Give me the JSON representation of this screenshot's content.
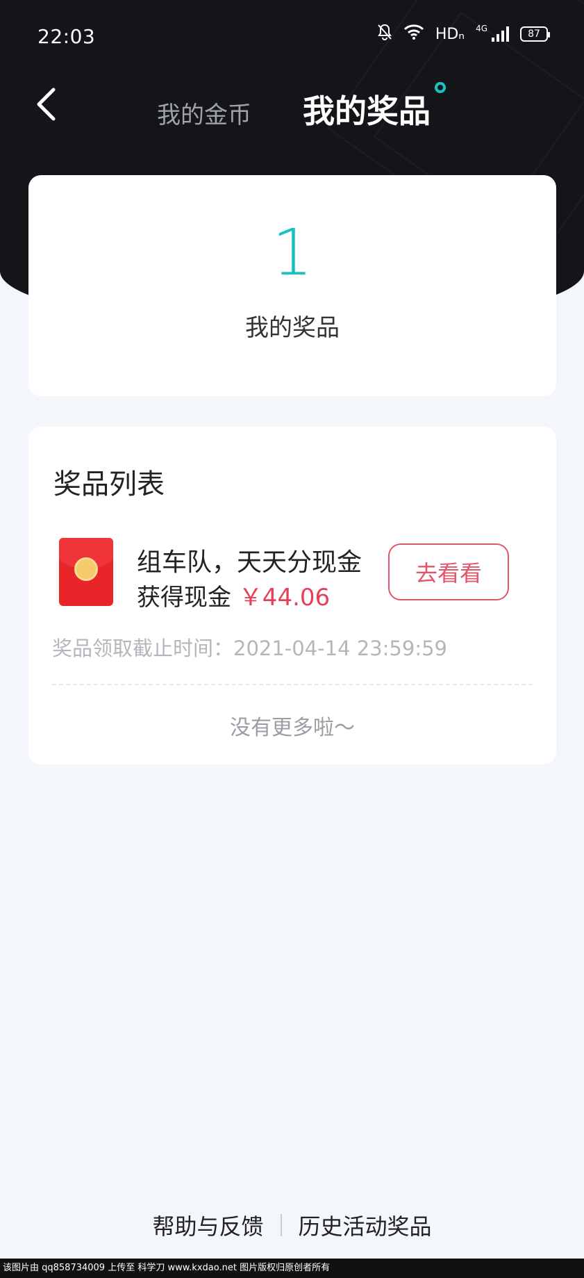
{
  "status_bar": {
    "time": "22:03",
    "network_hd": "HDₙ",
    "network_gen": "4G",
    "battery": "87"
  },
  "nav": {
    "tab_coins": "我的金币",
    "tab_prizes": "我的奖品"
  },
  "summary": {
    "count": "1",
    "label": "我的奖品"
  },
  "prize_list": {
    "title": "奖品列表",
    "items": [
      {
        "name": "组车队，天天分现金",
        "amount_prefix": "获得现金",
        "amount": "￥44.06",
        "button": "去看看",
        "deadline": "奖品领取截止时间：2021-04-14 23:59:59"
      }
    ],
    "end_text": "没有更多啦～"
  },
  "footer": {
    "help": "帮助与反馈",
    "history": "历史活动奖品"
  },
  "watermark": "该图片由 qq858734009 上传至 科学刀 www.kxdao.net 图片版权归原创者所有",
  "colors": {
    "accent": "#19bfc2",
    "money": "#e4405a",
    "header_bg": "#141519"
  }
}
